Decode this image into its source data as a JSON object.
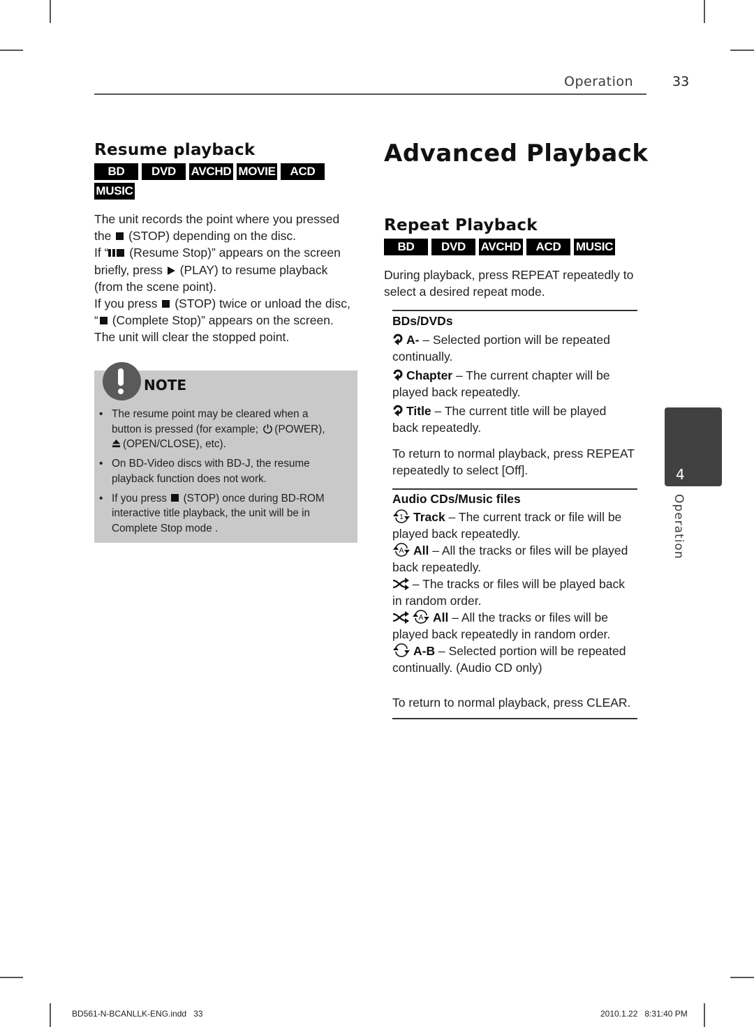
{
  "header": {
    "section": "Operation",
    "page_number": "33"
  },
  "resume": {
    "title": "Resume playback",
    "badges": [
      "BD",
      "DVD",
      "AVCHD",
      "MOVIE",
      "ACD",
      "MUSIC"
    ],
    "lines": [
      "The unit records the point where you pressed",
      "(STOP) depending on the disc.",
      "(Resume Stop)” appears on the screen",
      "(PLAY) to resume playback",
      "(from the scene point).",
      "(STOP) twice or unload the disc,",
      "(Complete Stop)” appears on the screen.",
      "The unit will clear the stopped point."
    ],
    "prefixes": {
      "the": "the",
      "if_quote": "If “",
      "briefly": "briefly, press",
      "if_you_press": "If you press",
      "open_quote": "“"
    }
  },
  "note": {
    "title": "NOTE",
    "items": [
      {
        "lines": [
          "The resume point may be cleared when a",
          "button is pressed (for example;",
          "(POWER),",
          "(OPEN/CLOSE), etc)."
        ]
      },
      {
        "lines": [
          "On BD-Video discs with BD-J, the resume",
          "playback function does not work."
        ]
      },
      {
        "lines": [
          "If you press",
          "(STOP) once during BD-ROM",
          "interactive title playback, the unit will be in",
          "Complete Stop mode ."
        ]
      }
    ]
  },
  "main": {
    "title": "Advanced Playback",
    "repeat": {
      "title": "Repeat Playback",
      "badges": [
        "BD",
        "DVD",
        "AVCHD",
        "ACD",
        "MUSIC"
      ],
      "intro": [
        "During playback, press REPEAT repeatedly to",
        "select a desired repeat mode."
      ],
      "bd_dvd": {
        "heading": "BDs/DVDs",
        "entries": [
          {
            "icon": "repeat-icon",
            "label": "A-",
            "desc1": " – Selected portion will be repeated",
            "desc2": "continually."
          },
          {
            "icon": "repeat-icon",
            "label": "Chapter",
            "desc1": " – The current chapter will be",
            "desc2": "played back repeatedly."
          },
          {
            "icon": "repeat-icon",
            "label": "Title",
            "desc1": " – The current title will be played",
            "desc2": "back repeatedly."
          }
        ],
        "return_note": [
          "To return to normal playback, press REPEAT",
          "repeatedly to select [Off]."
        ]
      },
      "audio": {
        "heading": "Audio CDs/Music files",
        "entries": [
          {
            "icon": "repeat-one-icon",
            "label": "Track",
            "desc1": " – The current track or file will be",
            "desc2": "played back repeatedly."
          },
          {
            "icon": "repeat-all-icon",
            "label": "All",
            "desc1": " – All the tracks or files will be played",
            "desc2": "back repeatedly."
          },
          {
            "icon": "shuffle-icon",
            "label": "",
            "desc1": " – The tracks or files will be played back",
            "desc2": "in random order."
          },
          {
            "icon": "shuffle-repeat-all-icon",
            "label": "All",
            "desc1": " – All the tracks or files will be",
            "desc2": "played back repeatedly in random order."
          },
          {
            "icon": "repeat-ab-icon",
            "label": "A-B",
            "desc1": " – Selected portion will be repeated",
            "desc2": "continually. (Audio CD only)"
          }
        ],
        "return_note": "To return to normal playback, press CLEAR."
      }
    }
  },
  "side_tab": {
    "number": "4",
    "label": "Operation"
  },
  "footer": {
    "file": "BD561-N-BCANLLK-ENG.indd   33",
    "timestamp": "2010.1.22   8:31:40 PM"
  },
  "colors": {
    "note_bg": "#c9c9c9",
    "tab_bg": "#414141",
    "badge_bg": "#000000"
  }
}
